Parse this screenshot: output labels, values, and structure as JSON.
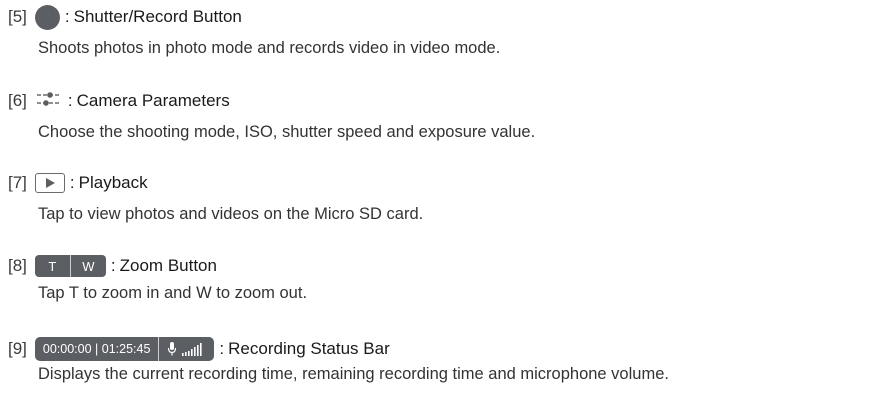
{
  "items": [
    {
      "number": "[5]",
      "icon": "shutter-circle-icon",
      "title": "Shutter/Record Button",
      "description": "Shoots photos in photo mode and records video in video mode."
    },
    {
      "number": "[6]",
      "icon": "sliders-icon",
      "title": "Camera Parameters",
      "description": "Choose the shooting mode, ISO, shutter speed and exposure value."
    },
    {
      "number": "[7]",
      "icon": "play-icon",
      "title": "Playback",
      "description": "Tap to view photos and videos on the Micro SD card."
    },
    {
      "number": "[8]",
      "icon": "zoom-pill",
      "zoom_in_label": "T",
      "zoom_out_label": "W",
      "title": "Zoom Button",
      "description": "Tap T to zoom in and W to zoom out."
    },
    {
      "number": "[9]",
      "icon": "status-bar-pill",
      "status_text": "00:00:00 | 01:25:45",
      "title": "Recording Status Bar",
      "description": "Displays the current recording time, remaining recording time and microphone volume."
    }
  ],
  "separator": ":",
  "colors": {
    "icon_fill": "#5b5e63",
    "text": "#231f20"
  }
}
